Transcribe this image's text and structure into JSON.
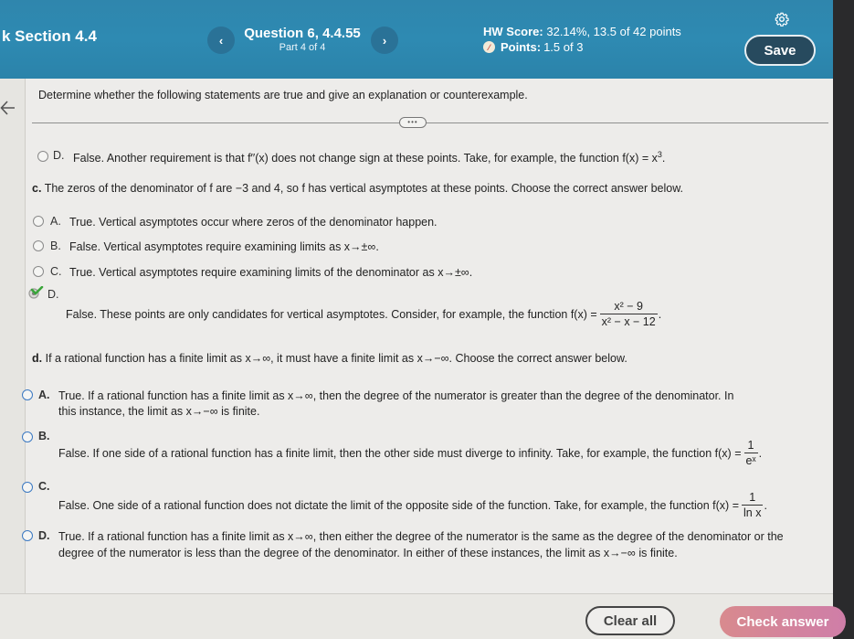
{
  "header": {
    "section_title": "k Section 4.4",
    "question_title": "Question 6, 4.4.55",
    "question_part": "Part 4 of 4",
    "prev_icon": "chevron-left-icon",
    "next_icon": "chevron-right-icon",
    "hw_score_label": "HW Score:",
    "hw_score_value": "32.14%, 13.5 of 42 points",
    "points_label": "Points:",
    "points_value": "1.5 of 3",
    "points_icon": "partial-credit-icon",
    "settings_icon": "gear-icon",
    "save_label": "Save",
    "prev_glyph": "‹",
    "next_glyph": "›"
  },
  "content": {
    "instructions": "Determine whether the following statements are true and give an explanation or counterexample.",
    "more_glyph": "•••",
    "part_b_option_d": {
      "letter": "D.",
      "text_before": "False. Another requirement is that f′′(x) does not change sign at these points. Take, for example, the function f(x) = x",
      "exponent": "3",
      "text_after": "."
    },
    "part_c": {
      "label": "c.",
      "prompt": "The zeros of the denominator of f are −3 and 4, so f has vertical asymptotes at these points. Choose the correct answer below.",
      "options": [
        {
          "letter": "A.",
          "text": "True. Vertical asymptotes occur where zeros of the denominator happen."
        },
        {
          "letter": "B.",
          "text": "False. Vertical asymptotes require examining limits as x→±∞."
        },
        {
          "letter": "C.",
          "text": "True. Vertical asymptotes require examining limits of the denominator as x→±∞."
        },
        {
          "letter": "D.",
          "text": "False. These points are only candidates for vertical asymptotes. Consider, for example, the function f(x) =",
          "frac_num": "x² − 9",
          "frac_den": "x² − x − 12",
          "suffix": ".",
          "selected": true,
          "status": "correct"
        }
      ]
    },
    "part_d": {
      "label": "d.",
      "prompt": "If a rational function has a finite limit as x→∞, it must have a finite limit as x→−∞. Choose the correct answer below.",
      "options": [
        {
          "letter": "A.",
          "line1": "True. If a rational function has a finite limit as x→∞, then the degree of the numerator is greater than the degree of the denominator. In",
          "line2": "this instance, the limit as x→−∞ is finite."
        },
        {
          "letter": "B.",
          "text": "False. If one side of a rational function has a finite limit, then the other side must diverge to infinity. Take, for example, the function f(x) =",
          "frac_num": "1",
          "frac_den": "eˣ",
          "suffix": "."
        },
        {
          "letter": "C.",
          "text": "False. One side of a rational function does not dictate the limit of the opposite side of the function. Take, for example, the function f(x) =",
          "frac_num": "1",
          "frac_den": "ln x",
          "suffix": "."
        },
        {
          "letter": "D.",
          "line1": "True. If a rational function has a finite limit as x→∞, then either the degree of the numerator is the same as the degree of the denominator or the",
          "line2": "degree of the numerator is less than the degree of the denominator. In either of these instances, the limit as x→−∞ is finite."
        }
      ]
    }
  },
  "footer": {
    "clear_label": "Clear all",
    "check_label": "Check answer"
  },
  "colors": {
    "header_blue": "#2e8ab2",
    "save_bg": "#274a5e",
    "check_answer_pink": "#d4849b",
    "correct_green": "#3aa53a"
  }
}
